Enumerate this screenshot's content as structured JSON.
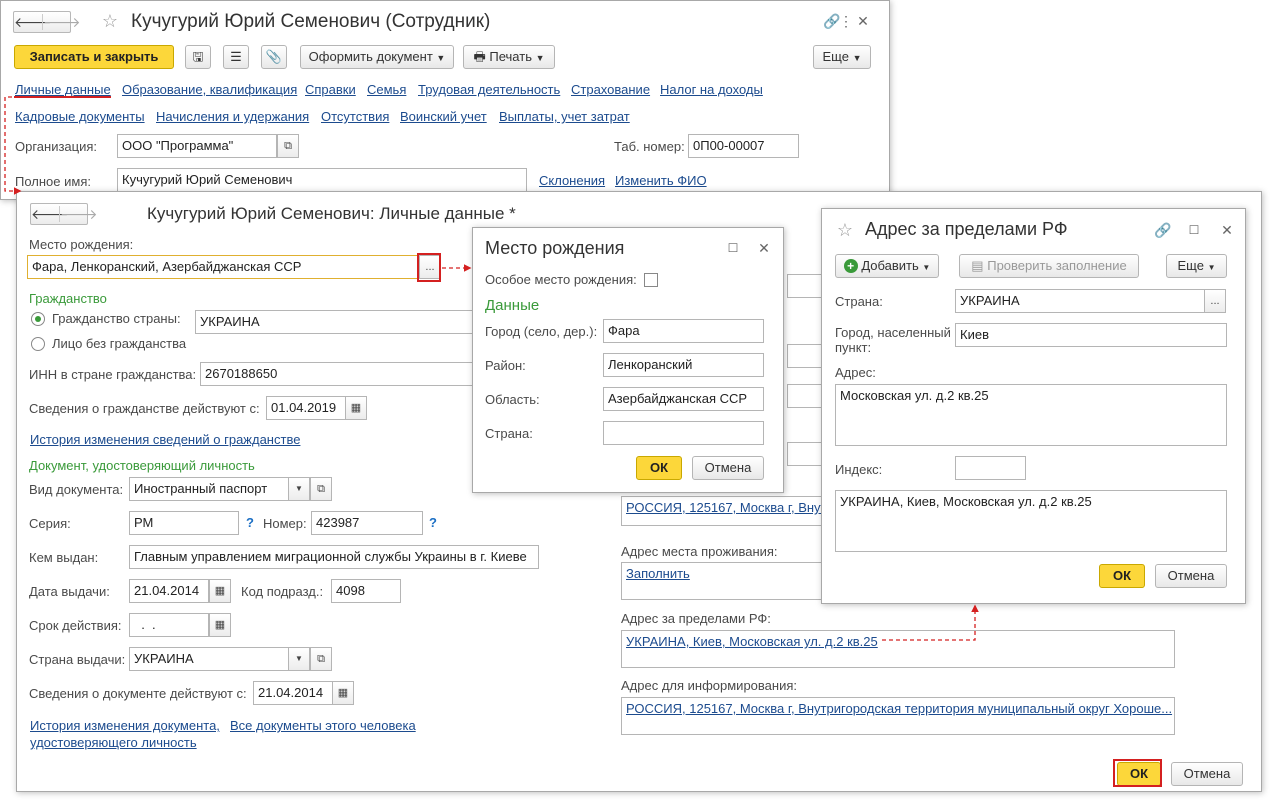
{
  "main": {
    "title": "Кучугурий Юрий Семенович (Сотрудник)",
    "save_close": "Записать и закрыть",
    "create_doc": "Оформить документ",
    "print": "Печать",
    "more": "Еще",
    "links_row1": [
      "Личные данные",
      "Образование, квалификация",
      "Справки",
      "Семья",
      "Трудовая деятельность",
      "Страхование",
      "Налог на доходы"
    ],
    "links_row2": [
      "Кадровые документы",
      "Начисления и удержания",
      "Отсутствия",
      "Воинский учет",
      "Выплаты, учет затрат"
    ],
    "org_label": "Организация:",
    "org_value": "ООО \"Программа\"",
    "tab_label": "Таб. номер:",
    "tab_value": "0П00-00007",
    "fullname_label": "Полное имя:",
    "fullname_value": "Кучугурий Юрий Семенович",
    "declensions": "Склонения",
    "change_fio": "Изменить ФИО"
  },
  "personal": {
    "title": "Кучугурий Юрий Семенович: Личные данные *",
    "birthplace_label": "Место рождения:",
    "birthplace_value": "Фара, Ленкоранский, Азербайджанская ССР",
    "dots": "...",
    "citizenship_group": "Гражданство",
    "citizen_country_label": "Гражданство страны:",
    "citizen_country_value": "УКРАИНА",
    "stateless_label": "Лицо без гражданства",
    "inn_label": "ИНН в стране гражданства:",
    "inn_value": "2670188650",
    "citizen_valid_label": "Сведения о гражданстве действуют с:",
    "citizen_valid_value": "01.04.2019",
    "citizen_history": "История изменения сведений о гражданстве",
    "doc_group": "Документ, удостоверяющий личность",
    "doc_type_label": "Вид документа:",
    "doc_type_value": "Иностранный паспорт",
    "series_label": "Серия:",
    "series_value": "РМ",
    "number_label": "Номер:",
    "number_value": "423987",
    "q": "?",
    "issued_by_label": "Кем выдан:",
    "issued_by_value": "Главным управлением миграционной службы Украины в г. Киеве",
    "issue_date_label": "Дата выдачи:",
    "issue_date_value": "21.04.2014",
    "dept_code_label": "Код подразд.:",
    "dept_code_value": "4098",
    "valid_until_label": "Срок действия:",
    "valid_until_value": "  .  .",
    "issue_country_label": "Страна выдачи:",
    "issue_country_value": "УКРАИНА",
    "doc_valid_label": "Сведения о документе действуют с:",
    "doc_valid_value": "21.04.2014",
    "doc_history_1": "История изменения документа,",
    "doc_history_2": "удостоверяющего личность",
    "all_docs": "Все документы этого человека",
    "addr_reg_value": "РОССИЯ, 125167, Москва г, Внутригоро",
    "addr_live_label": "Адрес места проживания:",
    "addr_live_value": "Заполнить",
    "addr_abroad_label": "Адрес за пределами РФ:",
    "addr_abroad_value": "УКРАИНА, Киев, Московская ул. д.2 кв.25",
    "addr_info_label": "Адрес для информирования:",
    "addr_info_value": "РОССИЯ, 125167, Москва г, Внутригородская территория муниципальный округ Хороше...",
    "ok": "ОК",
    "cancel": "Отмена"
  },
  "birthplace": {
    "title": "Место рождения",
    "special_label": "Особое место рождения:",
    "data_group": "Данные",
    "city_label": "Город (село, дер.):",
    "city_value": "Фара",
    "district_label": "Район:",
    "district_value": "Ленкоранский",
    "region_label": "Область:",
    "region_value": "Азербайджанская ССР",
    "country_label": "Страна:",
    "country_value": "",
    "ok": "ОК",
    "cancel": "Отмена"
  },
  "abroad": {
    "title": "Адрес за пределами РФ",
    "add": "Добавить",
    "check": "Проверить заполнение",
    "more": "Еще",
    "country_label": "Страна:",
    "country_value": "УКРАИНА",
    "city_label_1": "Город, населенный",
    "city_label_2": "пункт:",
    "city_value": "Киев",
    "address_label": "Адрес:",
    "address_value": "Московская ул. д.2 кв.25",
    "index_label": "Индекс:",
    "index_value": "",
    "summary": "УКРАИНА, Киев, Московская ул. д.2 кв.25",
    "ok": "ОК",
    "cancel": "Отмена"
  }
}
